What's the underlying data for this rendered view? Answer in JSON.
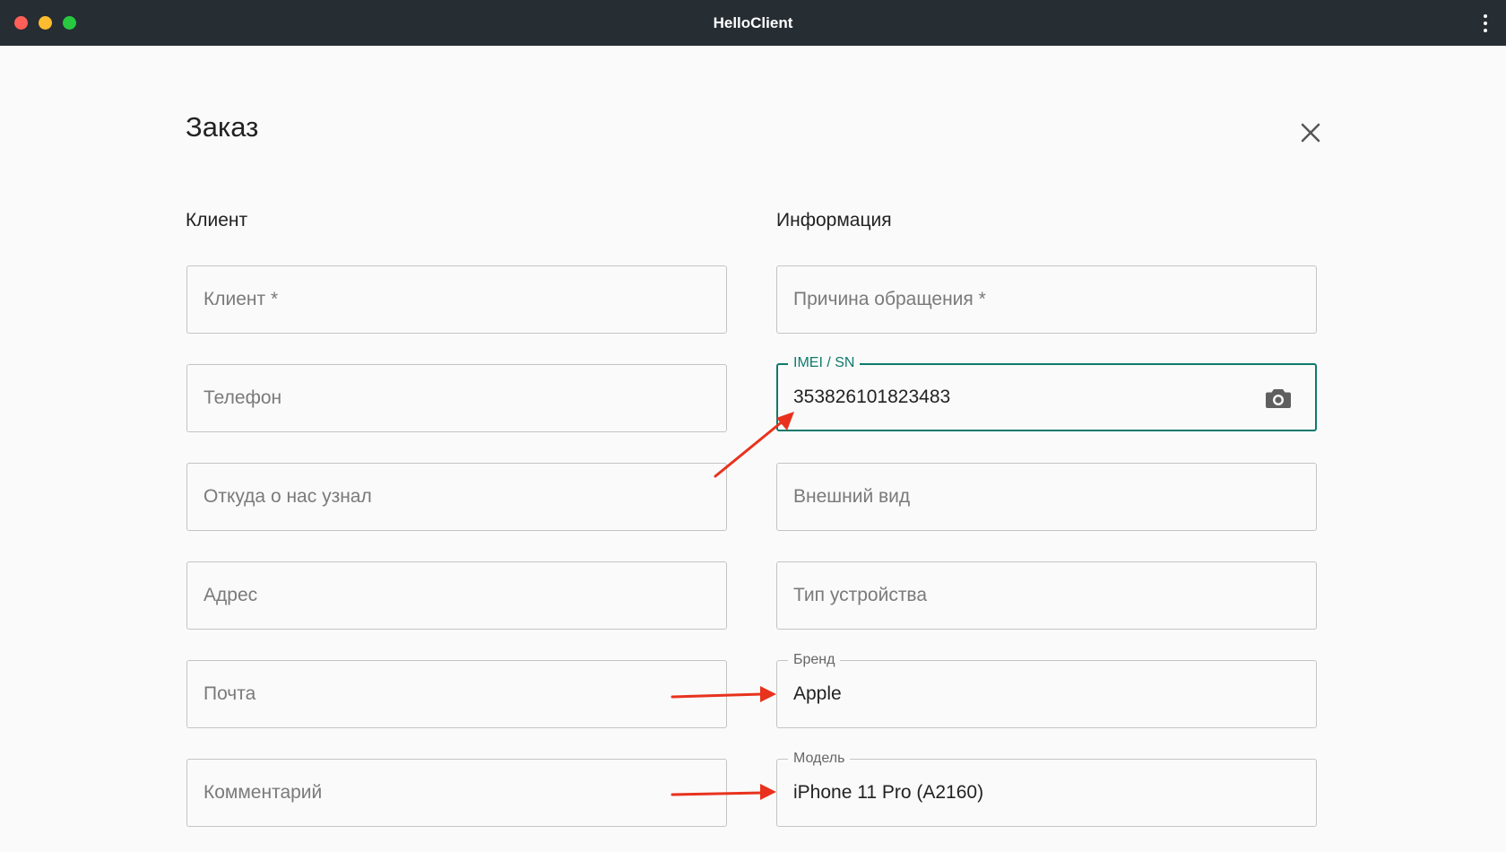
{
  "window": {
    "title": "HelloClient"
  },
  "page": {
    "title": "Заказ"
  },
  "client_section": {
    "title": "Клиент",
    "fields": {
      "client": {
        "placeholder": "Клиент *",
        "value": ""
      },
      "phone": {
        "placeholder": "Телефон",
        "value": ""
      },
      "source": {
        "placeholder": "Откуда о нас узнал",
        "value": ""
      },
      "address": {
        "placeholder": "Адрес",
        "value": ""
      },
      "email": {
        "placeholder": "Почта",
        "value": ""
      },
      "comment": {
        "placeholder": "Комментарий",
        "value": ""
      }
    }
  },
  "info_section": {
    "title": "Информация",
    "fields": {
      "reason": {
        "placeholder": "Причина обращения *",
        "value": ""
      },
      "imei": {
        "label": "IMEI / SN",
        "value": "353826101823483"
      },
      "appearance": {
        "placeholder": "Внешний вид",
        "value": ""
      },
      "device_type": {
        "placeholder": "Тип устройства",
        "value": ""
      },
      "brand": {
        "label": "Бренд",
        "value": "Apple"
      },
      "model": {
        "label": "Модель",
        "value": "iPhone 11 Pro (A2160)"
      }
    }
  },
  "colors": {
    "titlebar": "#262d33",
    "focus_accent": "#0f7a6c",
    "annotation_arrow": "#e8321e"
  },
  "icons": {
    "close": "close-icon",
    "camera": "camera-icon",
    "menu": "more-vertical-icon"
  }
}
